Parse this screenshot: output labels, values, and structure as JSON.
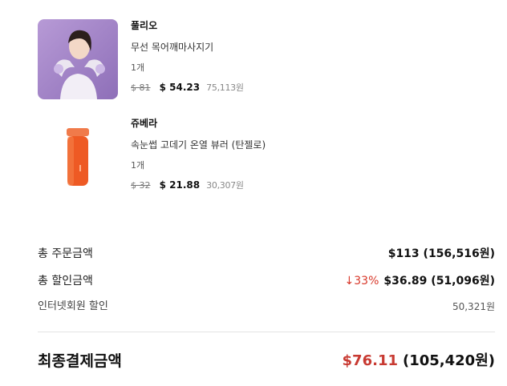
{
  "items": [
    {
      "brand": "풀리오",
      "name": "무선 목어깨마사지기",
      "qty": "1개",
      "original_price": "$ 81",
      "price": "$ 54.23",
      "price_krw": "75,113원",
      "image": "neck-shoulder-massager-photo"
    },
    {
      "brand": "쥬베라",
      "name": "속눈썹 고데기 온열 뷰러 (탄젤로)",
      "qty": "1개",
      "original_price": "$ 32",
      "price": "$ 21.88",
      "price_krw": "30,307원",
      "image": "orange-eyelash-curler-photo"
    }
  ],
  "summary": {
    "total_order_label": "총 주문금액",
    "total_order_value": "$113 (156,516원)",
    "total_discount_label": "총 할인금액",
    "discount_percent": "↓33%",
    "total_discount_value": "$36.89 (51,096원)",
    "internet_member_label": "인터넷회원 할인",
    "internet_member_value": "50,321원",
    "final_label": "최종결제금액",
    "final_usd": "$76.11",
    "final_krw": "(105,420원)"
  },
  "colors": {
    "accent_red": "#c83a32",
    "discount_red": "#d8382a",
    "divider": "#e3e3e3"
  }
}
